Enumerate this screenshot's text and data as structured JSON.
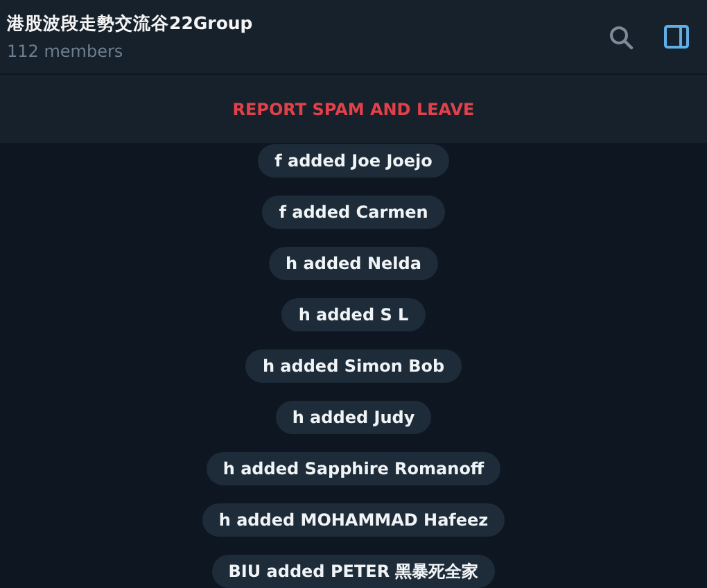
{
  "header": {
    "title": "港股波段走勢交流谷22Group",
    "subtitle": "112 members"
  },
  "report_bar": {
    "label": "REPORT SPAM AND LEAVE"
  },
  "messages": [
    {
      "text": "f added Joe Joejo"
    },
    {
      "text": "f added Carmen"
    },
    {
      "text": "h added Nelda"
    },
    {
      "text": "h added S L"
    },
    {
      "text": "h added Simon Bob"
    },
    {
      "text": "h added Judy"
    },
    {
      "text": "h added Sapphire Romanoff"
    },
    {
      "text": "h added MOHAMMAD Hafeez"
    },
    {
      "text": "BIU added PETER 黑暴死全家"
    }
  ]
}
